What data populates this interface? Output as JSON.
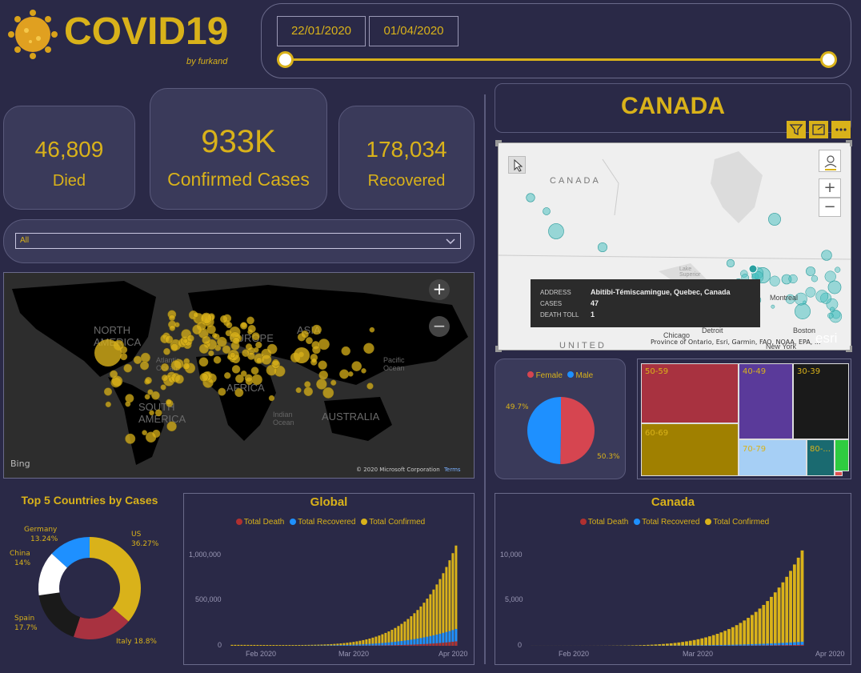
{
  "header": {
    "title": "COVID19",
    "byline": "by furkand",
    "date_start": "22/01/2020",
    "date_end": "01/04/2020",
    "slider_start_fraction": 0,
    "slider_end_fraction": 1
  },
  "kpis": {
    "died_value": "46,809",
    "died_label": "Died",
    "confirmed_value": "933K",
    "confirmed_label": "Confirmed Cases",
    "recovered_value": "178,034",
    "recovered_label": "Recovered"
  },
  "country_filter": {
    "selected": "All"
  },
  "world_map": {
    "continent_labels": [
      "NORTH AMERICA",
      "EUROPE",
      "ASIA",
      "AFRICA",
      "SOUTH AMERICA",
      "AUSTRALIA"
    ],
    "ocean_labels": [
      "Atlantic Ocean",
      "Pacific Ocean",
      "Indian Ocean"
    ],
    "attribution": "© 2020 Microsoft Corporation",
    "terms": "Terms",
    "provider": "Bing",
    "zoom_in": "+",
    "zoom_out": "−"
  },
  "canada": {
    "title": "CANADA",
    "map_labels": {
      "country": "CANADA",
      "bottom": "UNITED",
      "chicago": "Chicago",
      "detroit": "Detroit",
      "montreal": "Montreal",
      "boston": "Boston",
      "newyork": "New York",
      "lake": "Lake Superior"
    },
    "map_attribution": "Province of Ontario, Esri, Garmin, FAO, NOAA, EPA, ...",
    "esri": "esri",
    "tooltip": {
      "address_label": "ADDRESS",
      "address_value": "Abitibi-Témiscamingue, Quebec, Canada",
      "cases_label": "CASES",
      "cases_value": "47",
      "death_label": "DEATH TOLL",
      "death_value": "1"
    }
  },
  "gender_pie": {
    "legend": [
      "Female",
      "Male"
    ],
    "female_pct_label": "50.3%",
    "male_pct_label": "49.7%",
    "colors": {
      "female": "#d64550",
      "male": "#1e90ff"
    }
  },
  "age_treemap": {
    "cells": [
      "50-59",
      "40-49",
      "30-39",
      "60-69",
      "70-79",
      "80-..."
    ],
    "colors": [
      "#a83240",
      "#5a3a9a",
      "#1a1a1a",
      "#a08000",
      "#a6cff5",
      "#1a6a70",
      "#2ecc40",
      "#e05050"
    ]
  },
  "top5": {
    "title": "Top 5 Countries by Cases",
    "labels": [
      {
        "name": "US",
        "pct": "36.27%"
      },
      {
        "name": "Italy",
        "pct": "18.8%"
      },
      {
        "name": "Spain",
        "pct": "17.7%"
      },
      {
        "name": "China",
        "pct": "14%"
      },
      {
        "name": "Germany",
        "pct": "13.24%"
      }
    ],
    "italy_label": "Italy 18.8%"
  },
  "global_chart": {
    "title": "Global",
    "legend": [
      "Total Death",
      "Total Recovered",
      "Total Confirmed"
    ],
    "y_ticks": [
      "1,000,000",
      "500,000",
      "0"
    ],
    "x_ticks": [
      "Feb 2020",
      "Mar 2020",
      "Apr 2020"
    ]
  },
  "canada_chart": {
    "title": "Canada",
    "legend": [
      "Total Death",
      "Total Recovered",
      "Total Confirmed"
    ],
    "y_ticks": [
      "10,000",
      "5,000",
      "0"
    ],
    "x_ticks": [
      "Feb 2020",
      "Mar 2020",
      "Apr 2020"
    ]
  },
  "colors": {
    "accent": "#d9b21a",
    "death": "#b03030",
    "recovered": "#1e90ff",
    "confirmed": "#d9b21a"
  },
  "chart_data": [
    {
      "type": "pie",
      "title": "Top 5 Countries by Cases",
      "categories": [
        "US",
        "Italy",
        "Spain",
        "China",
        "Germany"
      ],
      "values": [
        36.27,
        18.8,
        17.7,
        14,
        13.24
      ]
    },
    {
      "type": "pie",
      "title": "",
      "categories": [
        "Female",
        "Male"
      ],
      "values": [
        50.3,
        49.7
      ]
    },
    {
      "type": "bar",
      "title": "Global",
      "x": [
        "Feb 2020",
        "Mar 2020",
        "Apr 2020"
      ],
      "series": [
        {
          "name": "Total Death",
          "values": [
            0,
            5000,
            46809
          ]
        },
        {
          "name": "Total Recovered",
          "values": [
            500,
            60000,
            178034
          ]
        },
        {
          "name": "Total Confirmed",
          "values": [
            10000,
            90000,
            1060000
          ]
        }
      ],
      "ylim": [
        0,
        1100000
      ]
    },
    {
      "type": "bar",
      "title": "Canada",
      "x": [
        "Feb 2020",
        "Mar 2020",
        "Apr 2020"
      ],
      "series": [
        {
          "name": "Total Death",
          "values": [
            0,
            0,
            110
          ]
        },
        {
          "name": "Total Recovered",
          "values": [
            0,
            10,
            470
          ]
        },
        {
          "name": "Total Confirmed",
          "values": [
            4,
            30,
            11000
          ]
        }
      ],
      "ylim": [
        0,
        12000
      ]
    }
  ]
}
